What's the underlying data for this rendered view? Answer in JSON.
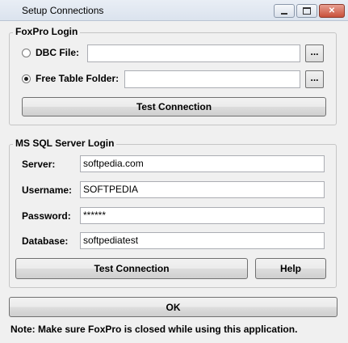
{
  "window": {
    "title": "Setup Connections"
  },
  "foxpro": {
    "group_label": "FoxPro Login",
    "dbc_file_label": "DBC File:",
    "dbc_file_value": "",
    "dbc_browse_label": "...",
    "dbc_selected": false,
    "free_table_label": "Free Table Folder:",
    "free_table_value": "",
    "free_table_browse_label": "...",
    "free_table_selected": true,
    "test_button_label": "Test Connection"
  },
  "mssql": {
    "group_label": "MS SQL Server Login",
    "server_label": "Server:",
    "server_value": "softpedia.com",
    "username_label": "Username:",
    "username_value": "SOFTPEDIA",
    "password_label": "Password:",
    "password_value": "******",
    "database_label": "Database:",
    "database_value": "softpediatest",
    "test_button_label": "Test Connection",
    "help_button_label": "Help"
  },
  "ok_button_label": "OK",
  "note": "Note: Make sure FoxPro is closed while using this application."
}
